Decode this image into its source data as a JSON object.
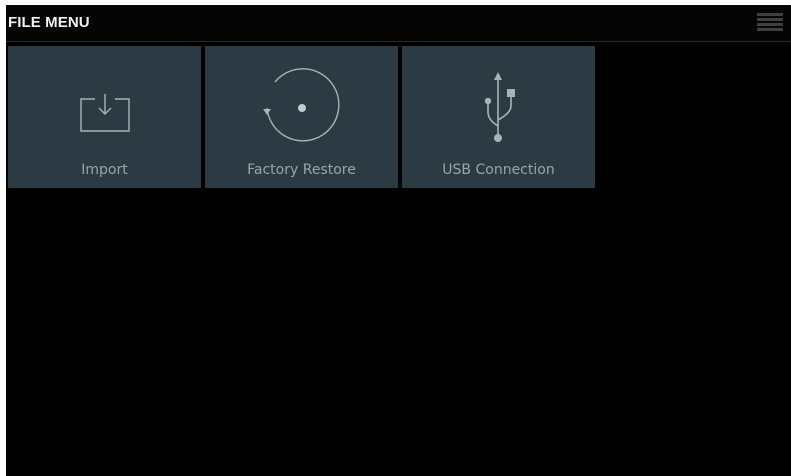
{
  "header": {
    "title": "FILE MENU",
    "menu_icon": "list-menu-icon"
  },
  "tiles": [
    {
      "label": "Import",
      "icon": "import-tray-icon"
    },
    {
      "label": "Factory Restore",
      "icon": "factory-restore-icon"
    },
    {
      "label": "USB Connection",
      "icon": "usb-icon"
    }
  ],
  "colors": {
    "background": "#000000",
    "tile": "#2c3a44",
    "tile_label": "#9aa3aa",
    "icon_stroke": "#aab2b8"
  }
}
